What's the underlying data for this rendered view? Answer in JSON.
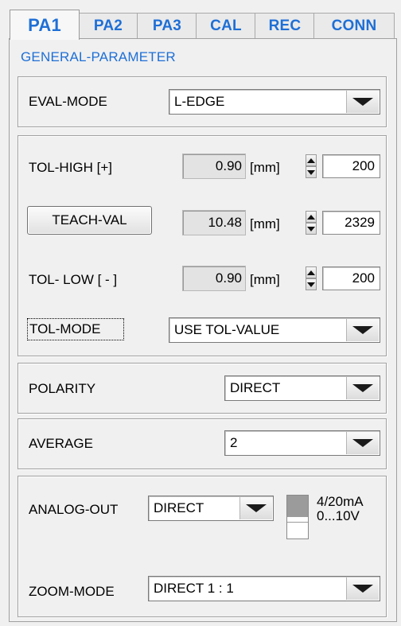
{
  "tabs": [
    {
      "label": "PA1",
      "active": true
    },
    {
      "label": "PA2",
      "active": false
    },
    {
      "label": "PA3",
      "active": false
    },
    {
      "label": "CAL",
      "active": false
    },
    {
      "label": "REC",
      "active": false
    },
    {
      "label": "CONN",
      "active": false
    }
  ],
  "section_title": "GENERAL-PARAMETER",
  "eval_mode": {
    "label": "EVAL-MODE",
    "value": "L-EDGE"
  },
  "tolerance": {
    "tol_high": {
      "label": "TOL-HIGH [+]",
      "value": "0.90",
      "unit": "[mm]",
      "spin_value": "200"
    },
    "teach": {
      "button_label": "TEACH-VAL",
      "value": "10.48",
      "unit": "[mm]",
      "spin_value": "2329"
    },
    "tol_low": {
      "label": "TOL- LOW [ - ]",
      "value": "0.90",
      "unit": "[mm]",
      "spin_value": "200"
    },
    "tol_mode": {
      "label": "TOL-MODE",
      "value": "USE TOL-VALUE"
    }
  },
  "polarity": {
    "label": "POLARITY",
    "value": "DIRECT"
  },
  "average": {
    "label": "AVERAGE",
    "value": "2"
  },
  "analog": {
    "analog_out": {
      "label": "ANALOG-OUT",
      "value": "DIRECT"
    },
    "switch": {
      "option_top": "4/20mA",
      "option_bottom": "0...10V"
    },
    "zoom_mode": {
      "label": "ZOOM-MODE",
      "value": "DIRECT 1 : 1"
    }
  },
  "colors": {
    "accent": "#1e6fd6",
    "background": "#f0f0f0"
  }
}
